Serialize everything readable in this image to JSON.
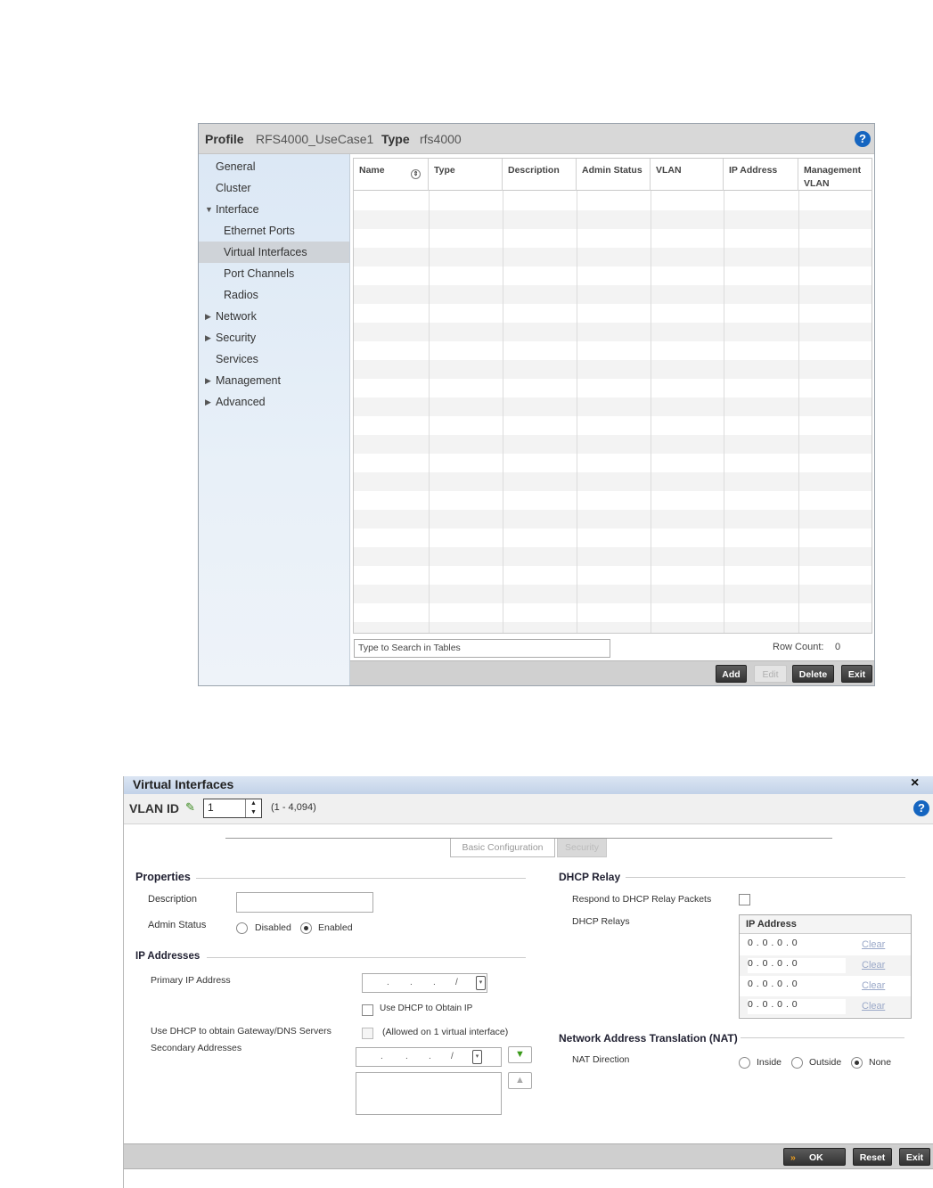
{
  "profile_panel": {
    "header": {
      "profile_label": "Profile",
      "profile_value": "RFS4000_UseCase1",
      "type_label": "Type",
      "type_value": "rfs4000",
      "help": "?"
    },
    "sidebar": {
      "items": [
        {
          "label": "General",
          "arrow": ""
        },
        {
          "label": "Cluster",
          "arrow": ""
        },
        {
          "label": "Interface",
          "arrow": "▼"
        },
        {
          "label": "Ethernet Ports",
          "arrow": ""
        },
        {
          "label": "Virtual Interfaces",
          "arrow": ""
        },
        {
          "label": "Port Channels",
          "arrow": ""
        },
        {
          "label": "Radios",
          "arrow": ""
        },
        {
          "label": "Network",
          "arrow": "▶"
        },
        {
          "label": "Security",
          "arrow": "▶"
        },
        {
          "label": "Services",
          "arrow": ""
        },
        {
          "label": "Management",
          "arrow": "▶"
        },
        {
          "label": "Advanced",
          "arrow": "▶"
        }
      ],
      "selected": "Virtual Interfaces"
    },
    "table": {
      "columns": [
        "Name",
        "Type",
        "Description",
        "Admin Status",
        "VLAN",
        "IP Address",
        "Management VLAN"
      ],
      "rows": []
    },
    "search_placeholder": "Type to Search in Tables",
    "row_count_label": "Row Count:",
    "row_count_value": "0",
    "buttons": {
      "add": "Add",
      "edit": "Edit",
      "delete": "Delete",
      "exit": "Exit"
    }
  },
  "vi_dialog": {
    "title": "Virtual Interfaces",
    "close": "×",
    "vlan_id_label": "VLAN ID",
    "vlan_id_value": "1",
    "vlan_range": "(1 - 4,094)",
    "help": "?",
    "tabs": {
      "basic": "Basic Configuration",
      "security": "Security"
    },
    "properties": {
      "title": "Properties",
      "description_label": "Description",
      "description_value": "",
      "admin_status_label": "Admin Status",
      "disabled_label": "Disabled",
      "enabled_label": "Enabled",
      "admin_status_selected": "Enabled"
    },
    "ip_addresses": {
      "title": "IP Addresses",
      "primary_label": "Primary IP Address",
      "use_dhcp_label": "Use DHCP to Obtain IP",
      "dhcp_gw_label": "Use DHCP to obtain Gateway/DNS Servers",
      "dhcp_gw_note": "(Allowed on 1 virtual interface)",
      "secondary_label": "Secondary Addresses"
    },
    "dhcp_relay": {
      "title": "DHCP Relay",
      "respond_label": "Respond to DHCP Relay Packets",
      "relays_label": "DHCP Relays",
      "table_header": "IP Address",
      "rows": [
        {
          "ip": "0  .  0  .  0  .  0",
          "clear": "Clear"
        },
        {
          "ip": "0  .  0  .  0  .  0",
          "clear": "Clear"
        },
        {
          "ip": "0  .  0  .  0  .  0",
          "clear": "Clear"
        },
        {
          "ip": "0  .  0  .  0  .  0",
          "clear": "Clear"
        }
      ]
    },
    "nat": {
      "title": "Network Address Translation (NAT)",
      "direction_label": "NAT Direction",
      "inside_label": "Inside",
      "outside_label": "Outside",
      "none_label": "None",
      "selected": "None"
    },
    "buttons": {
      "ok": "OK",
      "reset": "Reset",
      "exit": "Exit"
    },
    "colors": {
      "titlebar": "#c2d2e8",
      "help": "#1565c0",
      "clear_link": "#9aa8c8",
      "add_arrow": "#3a9a1a"
    }
  }
}
